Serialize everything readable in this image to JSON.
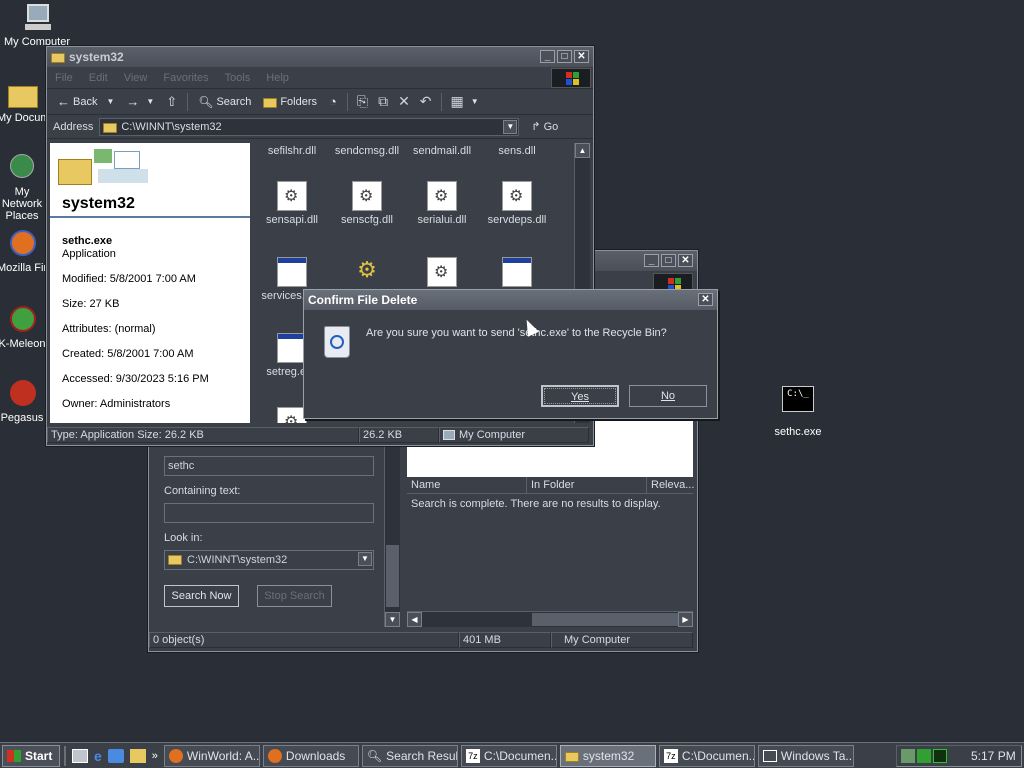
{
  "desktop": {
    "icons": [
      {
        "label": "My Computer"
      },
      {
        "label": "My Documents"
      },
      {
        "label": "My Network Places"
      },
      {
        "label": "Mozilla Firefox"
      },
      {
        "label": "K-Meleon"
      },
      {
        "label": "Pegasus"
      }
    ],
    "file_icon": {
      "label": "sethc.exe",
      "glyph": "C:\\_"
    }
  },
  "explorer": {
    "title": "system32",
    "menu": [
      "File",
      "Edit",
      "View",
      "Favorites",
      "Tools",
      "Help"
    ],
    "toolbar": {
      "back": "Back",
      "search": "Search",
      "folders": "Folders"
    },
    "address": {
      "label": "Address",
      "value": "C:\\WINNT\\system32",
      "go": "Go"
    },
    "left_pane": {
      "folder_name": "system32",
      "file_name": "sethc.exe",
      "file_type": "Application",
      "modified": "Modified: 5/8/2001 7:00 AM",
      "size": "Size: 27 KB",
      "attributes": "Attributes: (normal)",
      "created": "Created: 5/8/2001 7:00 AM",
      "accessed": "Accessed: 9/30/2023 5:16 PM",
      "owner": "Owner: Administrators"
    },
    "files_row1": [
      "sefilshr.dll",
      "sendcmsg.dll",
      "sendmail.dll",
      "sens.dll"
    ],
    "files_row2": [
      "sensapi.dll",
      "senscfg.dll",
      "serialui.dll",
      "servdeps.dll"
    ],
    "files_row3": [
      "services.exe",
      "",
      "",
      ""
    ],
    "files_row4": [
      "setreg.exe"
    ],
    "status": {
      "type_size": "Type: Application Size: 26.2 KB",
      "size": "26.2 KB",
      "location": "My Computer"
    }
  },
  "search_window": {
    "named_value": "sethc",
    "containing_label": "Containing text:",
    "containing_value": "",
    "lookin_label": "Look in:",
    "lookin_value": "C:\\WINNT\\system32",
    "search_now": "Search Now",
    "stop_search": "Stop Search",
    "columns": [
      "Name",
      "In Folder",
      "Releva..."
    ],
    "no_results": "Search is complete. There are no results to display.",
    "status": {
      "objects": "0 object(s)",
      "size": "401 MB",
      "location": "My Computer"
    }
  },
  "dialog": {
    "title": "Confirm File Delete",
    "message": "Are you sure you want to send 'sethc.exe' to the Recycle Bin?",
    "yes": "Yes",
    "no": "No"
  },
  "taskbar": {
    "start": "Start",
    "tasks": [
      {
        "label": "WinWorld: A...",
        "active": false
      },
      {
        "label": "Downloads",
        "active": false
      },
      {
        "label": "Search Results",
        "active": false
      },
      {
        "label": "C:\\Documen...",
        "active": false
      },
      {
        "label": "system32",
        "active": true
      },
      {
        "label": "C:\\Documen...",
        "active": false
      },
      {
        "label": "Windows Ta...",
        "active": false
      }
    ],
    "clock": "5:17 PM"
  }
}
